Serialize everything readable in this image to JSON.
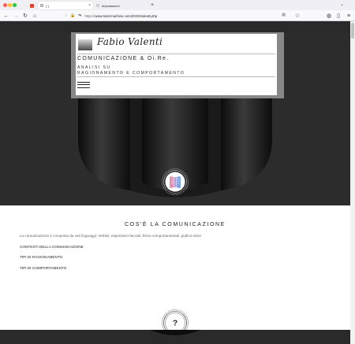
{
  "browser": {
    "tabs": [
      {
        "title": "( )",
        "active": true
      },
      {
        "title": "Impostazioni",
        "active": false
      }
    ],
    "new_tab_label": "+",
    "url": {
      "scheme": "https://",
      "host_path": "www.total-machine.com/2023/indexB.php"
    }
  },
  "site": {
    "logo_name": "Fabio Valenti",
    "brand_title": "COMUNICAZIONE & Oi.Re.",
    "subtitle_line1": "ANALISI SU",
    "subtitle_line2": "RAGIONAMENTO E COMPORTAMENTO"
  },
  "section": {
    "title": "COS'È LA COMUNICAZIONE",
    "description": "La comunicazione è composta da vari linguaggi: Verbali, espressivo-facciali, fisico-comportamentali, grafico-visivi",
    "links": [
      "CONTESTI DELLA COMUNICAZIONE",
      "TIPI DI RAGIONAMENTO",
      "TIPI DI COMPORTAMENTO"
    ],
    "question_mark": "?"
  },
  "colors": {
    "hero_bg": "#2b2b2b",
    "header_band": "#888888",
    "badge_fill": "#ffffff"
  }
}
